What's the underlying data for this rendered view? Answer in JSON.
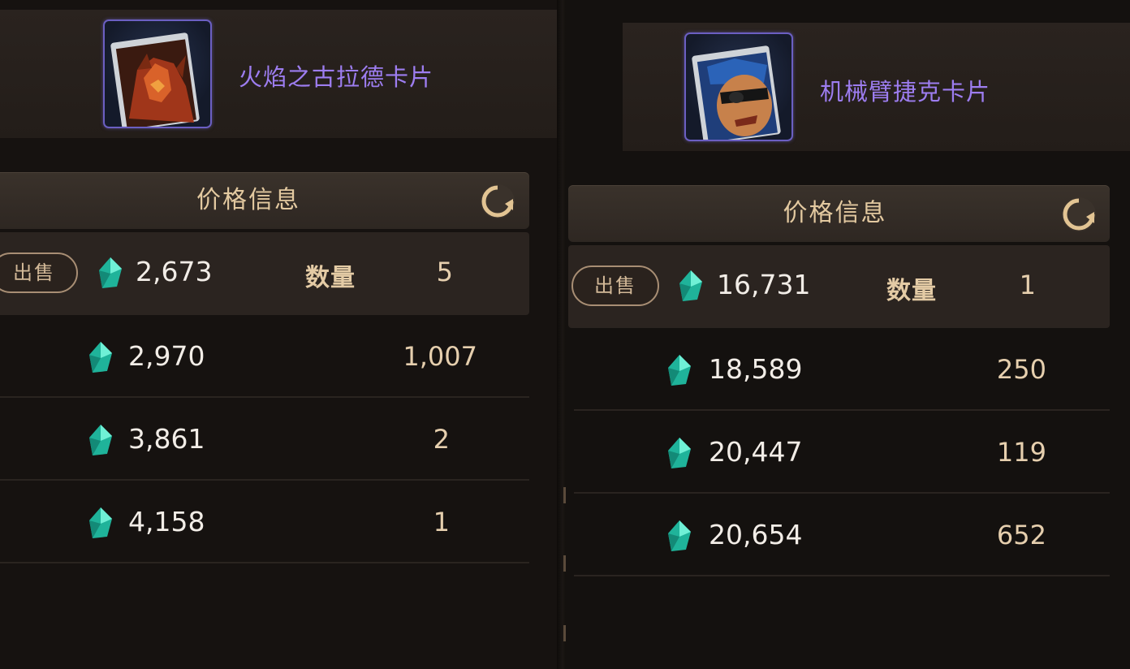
{
  "panels": [
    {
      "card_name": "火焰之古拉德卡片",
      "price_title": "价格信息",
      "sell_label": "出售",
      "qty_label": "数量",
      "listings": [
        {
          "price": "2,673",
          "qty": "5"
        },
        {
          "price": "2,970",
          "qty": "1,007"
        },
        {
          "price": "3,861",
          "qty": "2"
        },
        {
          "price": "4,158",
          "qty": "1"
        }
      ]
    },
    {
      "card_name": "机械臂捷克卡片",
      "price_title": "价格信息",
      "sell_label": "出售",
      "qty_label": "数量",
      "listings": [
        {
          "price": "16,731",
          "qty": "1"
        },
        {
          "price": "18,589",
          "qty": "250"
        },
        {
          "price": "20,447",
          "qty": "119"
        },
        {
          "price": "20,654",
          "qty": "652"
        }
      ]
    }
  ],
  "icons": {
    "refresh": "refresh-icon",
    "currency": "gem-icon"
  },
  "colors": {
    "card_name": "#9d7df0",
    "price_title": "#e3c9a0",
    "price_text": "#f2ede7",
    "gem": "#2fd6b4"
  }
}
